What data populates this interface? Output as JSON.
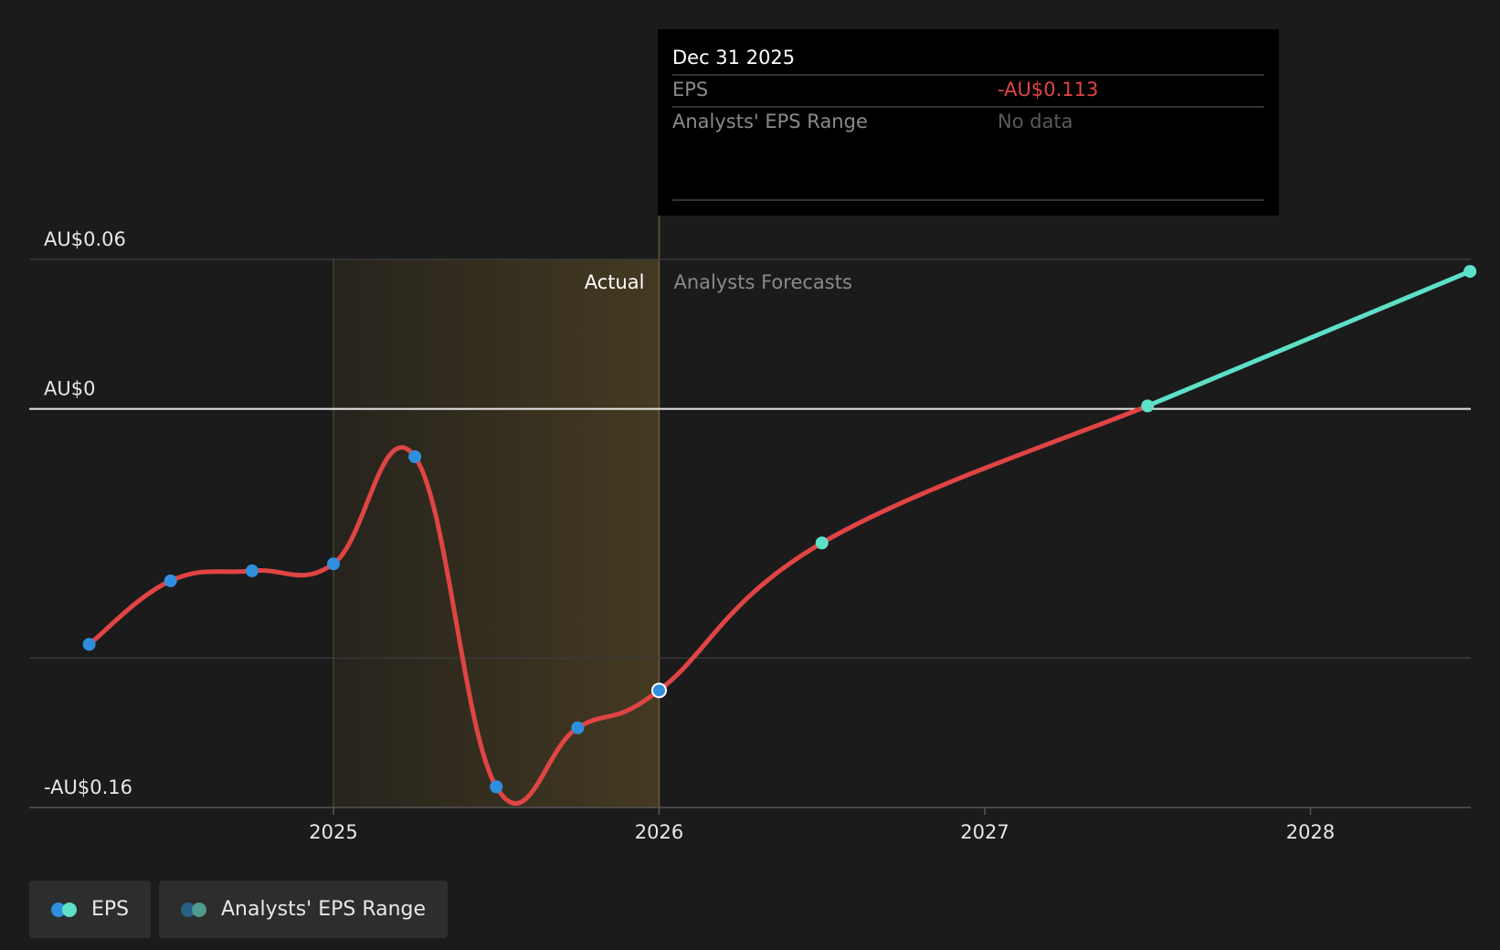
{
  "colors": {
    "background": "#1b1b1b",
    "eps_line": "#e04444",
    "actual_point": "#2f8fde",
    "forecast": "#5ee0c8",
    "actual_shade": "#d6a83a",
    "range_dark": "#2a5f86",
    "range_light": "#4e9a8c"
  },
  "tooltip": {
    "date": "Dec 31 2025",
    "eps_label": "EPS",
    "eps_value": "-AU$0.113",
    "range_label": "Analysts' EPS Range",
    "range_value": "No data"
  },
  "legend": {
    "eps_label": "EPS",
    "range_label": "Analysts' EPS Range"
  },
  "chart_data": {
    "type": "line",
    "y_tick_labels": [
      "AU$0.06",
      "AU$0",
      "-AU$0.16"
    ],
    "y_ticks": [
      0.06,
      0,
      -0.1,
      -0.16
    ],
    "ylim": [
      -0.16,
      0.06
    ],
    "xlim": [
      2024.07,
      2028.49
    ],
    "x_tick_labels": [
      "2025",
      "2026",
      "2027",
      "2028"
    ],
    "x_ticks": [
      2025,
      2026,
      2027,
      2028
    ],
    "actual_label": "Actual",
    "forecast_label": "Analysts Forecasts",
    "actual_region": [
      2025.0,
      2026.0
    ],
    "divider_x": 2026.0,
    "series": [
      {
        "name": "EPS",
        "kind": "actual",
        "points": [
          {
            "x": 2024.25,
            "y": -0.0945
          },
          {
            "x": 2024.5,
            "y": -0.069
          },
          {
            "x": 2024.75,
            "y": -0.065
          },
          {
            "x": 2025.0,
            "y": -0.0622
          },
          {
            "x": 2025.25,
            "y": -0.0192
          },
          {
            "x": 2025.5,
            "y": -0.1517
          },
          {
            "x": 2025.75,
            "y": -0.128
          },
          {
            "x": 2026.0,
            "y": -0.113
          }
        ]
      },
      {
        "name": "EPS",
        "kind": "forecast",
        "points": [
          {
            "x": 2026.0,
            "y": -0.113
          },
          {
            "x": 2026.5,
            "y": -0.0538
          },
          {
            "x": 2027.5,
            "y": 0.0012
          },
          {
            "x": 2028.49,
            "y": 0.0552
          }
        ]
      }
    ],
    "highlight_x": 2026.0,
    "legend": [
      "EPS",
      "Analysts' EPS Range"
    ],
    "grid": "horizontal"
  }
}
